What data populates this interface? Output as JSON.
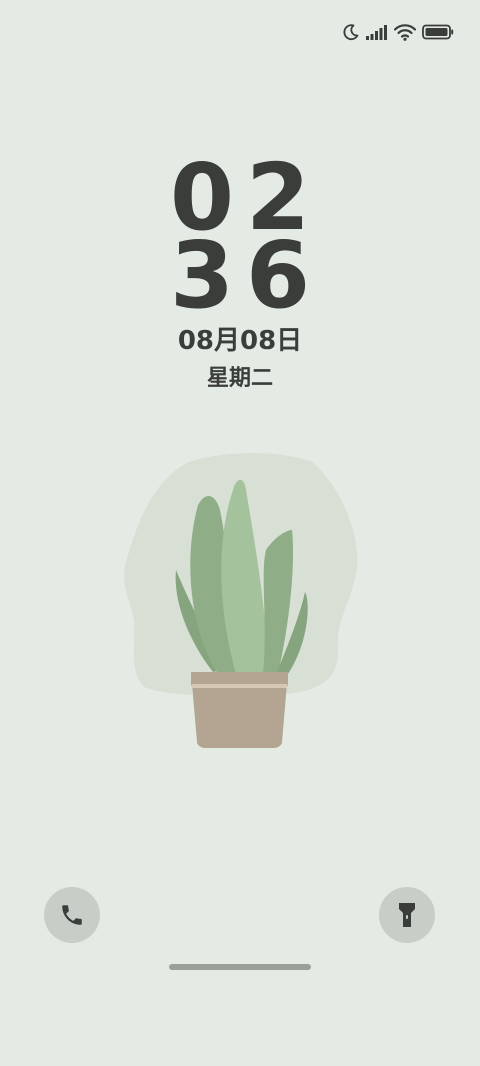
{
  "status_bar": {
    "icons": [
      "moon-icon",
      "signal-icon",
      "wifi-icon",
      "battery-icon"
    ]
  },
  "lockscreen": {
    "hours": "02",
    "minutes": "36",
    "date": "08月08日",
    "weekday": "星期二"
  },
  "shortcuts": {
    "left_icon": "phone-icon",
    "right_icon": "flashlight-icon"
  },
  "colors": {
    "background": "#e4ebe4",
    "text": "#3a3d3a",
    "button_bg": "#c7cdc7"
  }
}
